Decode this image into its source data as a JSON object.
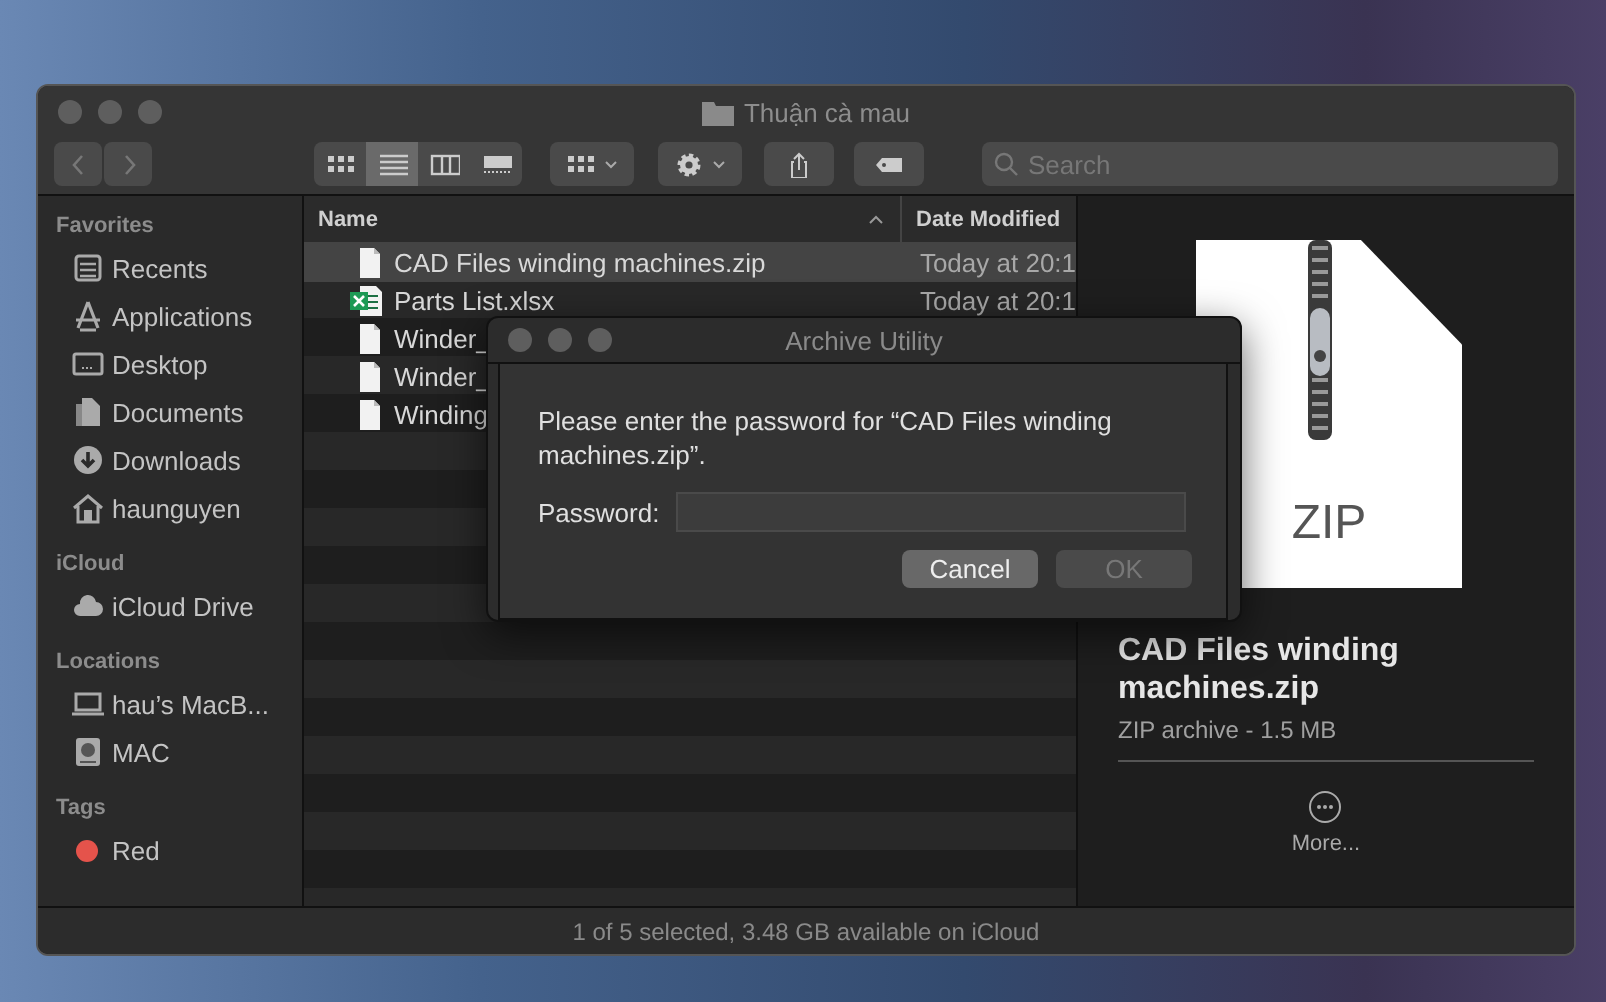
{
  "window": {
    "title": "Thuận cà mau"
  },
  "toolbar": {
    "view_modes": [
      {
        "kind": "icons",
        "selected": false
      },
      {
        "kind": "list",
        "selected": true
      },
      {
        "kind": "columns",
        "selected": false
      },
      {
        "kind": "gallery",
        "selected": false
      }
    ]
  },
  "search": {
    "placeholder": "Search"
  },
  "sidebar": {
    "sections": [
      {
        "title": "Favorites",
        "items": [
          {
            "label": "Recents",
            "kind": "recents"
          },
          {
            "label": "Applications",
            "kind": "applications"
          },
          {
            "label": "Desktop",
            "kind": "desktop"
          },
          {
            "label": "Documents",
            "kind": "documents"
          },
          {
            "label": "Downloads",
            "kind": "downloads"
          },
          {
            "label": "haunguyen",
            "kind": "home"
          }
        ]
      },
      {
        "title": "iCloud",
        "items": [
          {
            "label": "iCloud Drive",
            "kind": "cloud"
          }
        ]
      },
      {
        "title": "Locations",
        "items": [
          {
            "label": "hau’s MacB...",
            "kind": "laptop"
          },
          {
            "label": "MAC",
            "kind": "disk"
          }
        ]
      },
      {
        "title": "Tags",
        "items": [
          {
            "label": "Red",
            "kind": "tag",
            "color": "#e5534b"
          }
        ]
      }
    ]
  },
  "file_list": {
    "columns": [
      "Name",
      "Date Modified"
    ],
    "rows": [
      {
        "name": "CAD Files winding machines.zip",
        "date": "Today at 20:1",
        "kind": "document",
        "selected": true
      },
      {
        "name": "Parts List.xlsx",
        "date": "Today at 20:1",
        "kind": "spreadsheet",
        "selected": false
      },
      {
        "name": "Winder_",
        "kind": "document",
        "selected": false
      },
      {
        "name": "Winder_",
        "kind": "document",
        "selected": false
      },
      {
        "name": "Winding",
        "kind": "document",
        "selected": false
      }
    ]
  },
  "preview": {
    "icon_label": "ZIP",
    "title": "CAD Files winding machines.zip",
    "subtitle": "ZIP archive - 1.5 MB",
    "more": "More..."
  },
  "status_bar": "1 of 5 selected, 3.48 GB available on iCloud",
  "dialog": {
    "title": "Archive Utility",
    "message": "Please enter the password for “CAD Files winding machines.zip”.",
    "password_label": "Password:",
    "buttons": [
      {
        "label": "Cancel",
        "disabled": false
      },
      {
        "label": "OK",
        "disabled": true
      }
    ]
  }
}
